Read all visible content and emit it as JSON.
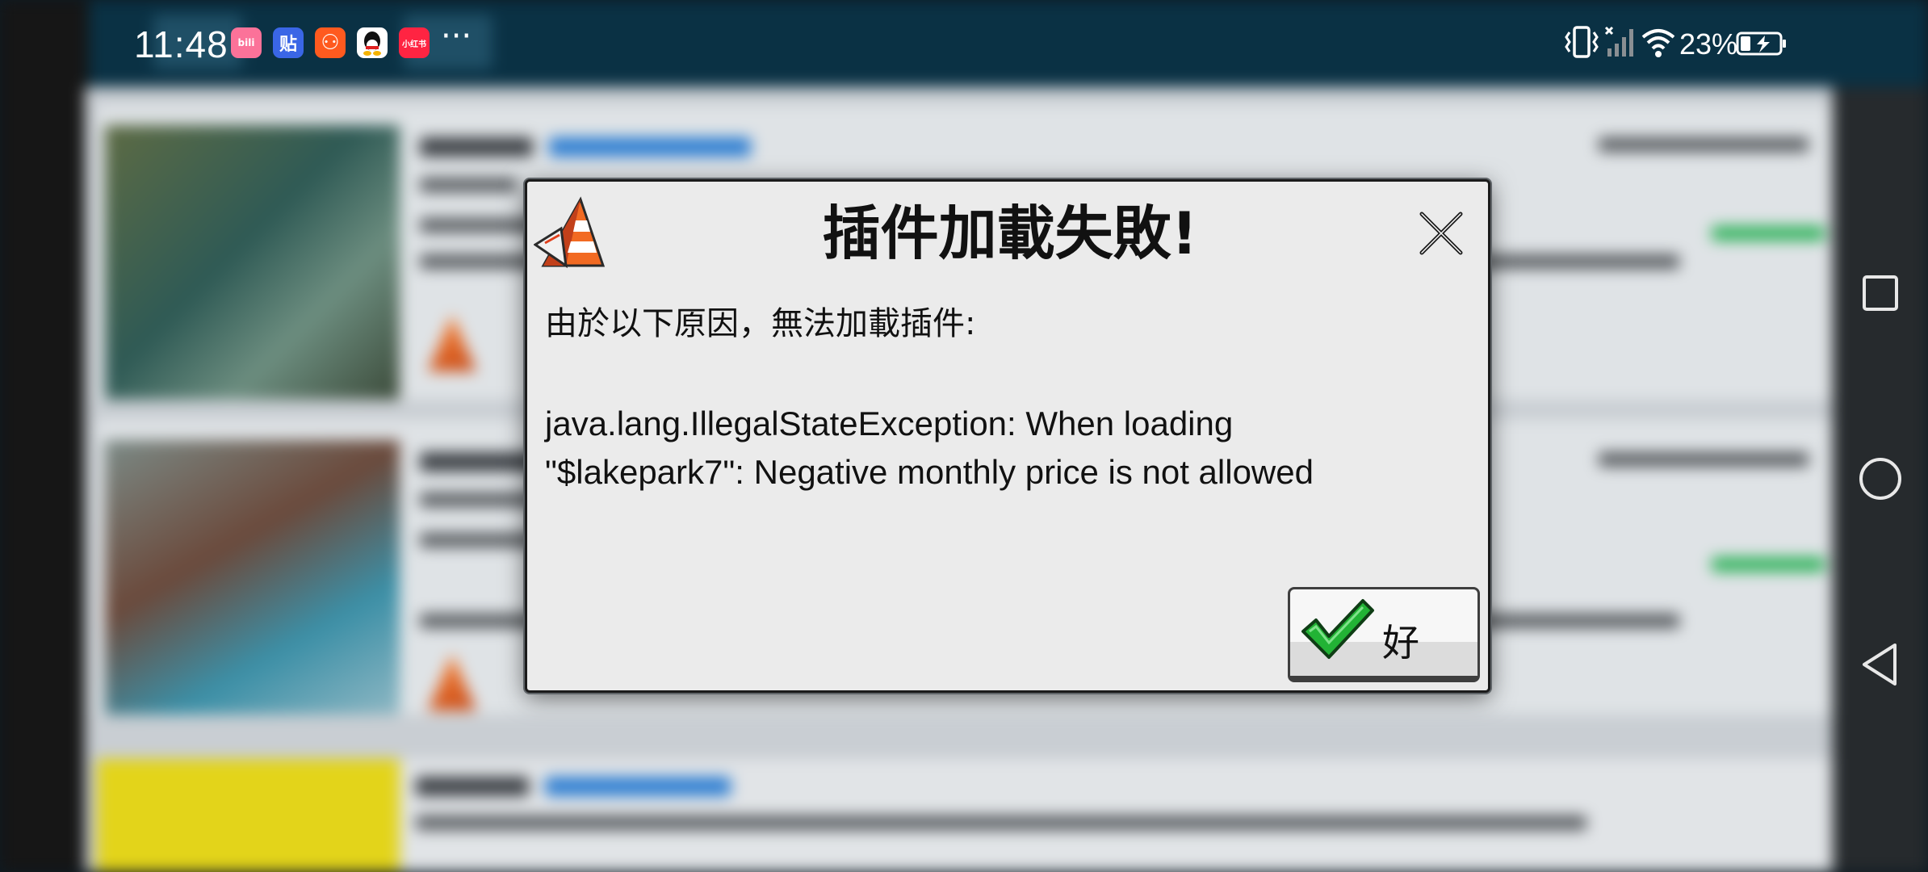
{
  "status_bar": {
    "time": "11:48",
    "apps": [
      {
        "name": "bilibili",
        "glyph": "bili",
        "color": "#fb7299"
      },
      {
        "name": "tieba",
        "glyph": "贴",
        "color": "#3a66e6"
      },
      {
        "name": "kuaishou",
        "glyph": "⚇",
        "color": "#ff5a1f"
      },
      {
        "name": "qq",
        "glyph": "🐧",
        "color": "#ffffff"
      },
      {
        "name": "xiaohongshu",
        "glyph": "小红书",
        "color": "#ff2442"
      }
    ],
    "more": "···",
    "battery_percent": "23%"
  },
  "dialog": {
    "title": "插件加載失敗!",
    "message": "由於以下原因，無法加載插件:",
    "detail_line1": "java.lang.IllegalStateException: When loading",
    "detail_line2": "\"$lakepark7\": Negative monthly price is not allowed",
    "ok_label": "好",
    "accent_red": "#e0401c",
    "accent_green": "#22b335"
  },
  "icons": {
    "warning": "warning-cone-icon",
    "close": "close-icon",
    "check": "checkmark-icon"
  }
}
